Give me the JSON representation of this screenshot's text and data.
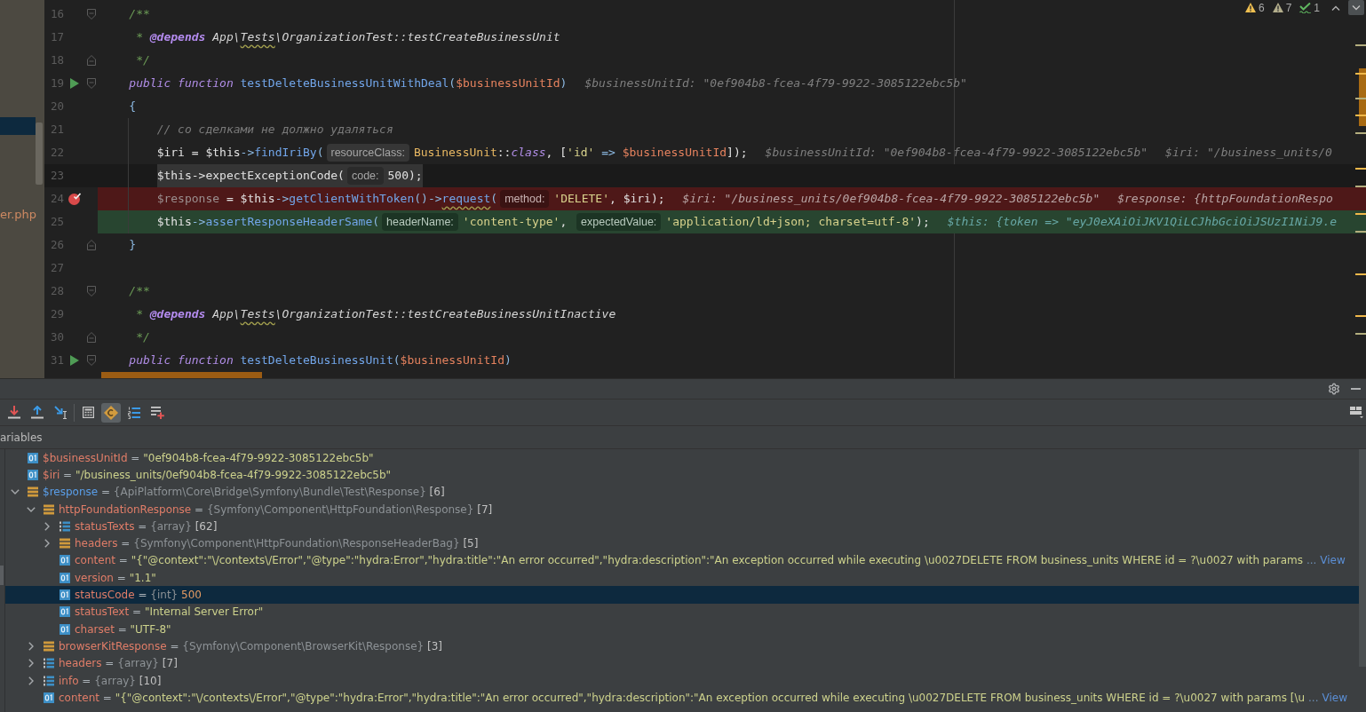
{
  "editor": {
    "project_panel": {
      "items": [
        {
          "selected": true
        },
        {
          "label": "er.php",
          "selected": false
        }
      ]
    },
    "problems": [
      {
        "kind": "warning",
        "count": "6"
      },
      {
        "kind": "weak_warning",
        "count": "7"
      },
      {
        "kind": "typo",
        "count": "1"
      }
    ],
    "lines": [
      {
        "number": "16",
        "kind": "code",
        "gutter": [
          {
            "kind": "fold_start"
          }
        ],
        "tokens": [
          {
            "kind": "doc",
            "text": "/**"
          }
        ]
      },
      {
        "number": "17",
        "kind": "code",
        "tokens": [
          {
            "kind": "doc",
            "text": " * "
          },
          {
            "kind": "doctag",
            "text": "@depends"
          },
          {
            "kind": "docref",
            "text": " App\\"
          },
          {
            "kind": "docref_typo",
            "text": "Tests"
          },
          {
            "kind": "docref",
            "text": "\\OrganizationTest::testCreateBusinessUnit"
          }
        ]
      },
      {
        "number": "18",
        "kind": "code",
        "gutter": [
          {
            "kind": "fold_end"
          }
        ],
        "tokens": [
          {
            "kind": "doc",
            "text": " */"
          }
        ]
      },
      {
        "number": "19",
        "kind": "code",
        "gutter": [
          {
            "kind": "run"
          },
          {
            "kind": "fold_start"
          }
        ],
        "tokens": [
          {
            "kind": "keyword",
            "text": "public function "
          },
          {
            "kind": "funcdef",
            "text": "testDeleteBusinessUnitWithDeal"
          },
          {
            "kind": "punct",
            "text": "("
          },
          {
            "kind": "param",
            "text": "$businessUnitId"
          },
          {
            "kind": "punct",
            "text": ")"
          },
          {
            "kind": "debug",
            "text": "$businessUnitId: \"0ef904b8-fcea-4f79-9922-3085122ebc5b\""
          }
        ]
      },
      {
        "number": "20",
        "kind": "code",
        "tokens": [
          {
            "kind": "punct",
            "text": "{"
          }
        ],
        "children": [
          {
            "number": "21",
            "kind": "code",
            "tokens": [
              {
                "kind": "comment",
                "text": "// со сделками не должно удаляться"
              }
            ]
          },
          {
            "number": "22",
            "kind": "code",
            "tokens": [
              {
                "kind": "var",
                "text": "$iri"
              },
              {
                "kind": "plain",
                "text": " = "
              },
              {
                "kind": "var",
                "text": "$this"
              },
              {
                "kind": "punct",
                "text": "->"
              },
              {
                "kind": "method",
                "text": "findIriBy"
              },
              {
                "kind": "punct",
                "text": "("
              },
              {
                "kind": "hint",
                "text": "resourceClass:"
              },
              {
                "kind": "class",
                "text": "BusinessUnit"
              },
              {
                "kind": "plain",
                "text": "::"
              },
              {
                "kind": "const",
                "text": "class"
              },
              {
                "kind": "plain",
                "text": ", ["
              },
              {
                "kind": "string",
                "text": "'id'"
              },
              {
                "kind": "punct",
                "text": " => "
              },
              {
                "kind": "param",
                "text": "$businessUnitId"
              },
              {
                "kind": "plain",
                "text": "]);"
              },
              {
                "kind": "debug",
                "text": "$businessUnitId: \"0ef904b8-fcea-4f79-9922-3085122ebc5b\""
              },
              {
                "kind": "debug",
                "text": "$iri: \"/business_units/0"
              }
            ]
          },
          {
            "number": "23",
            "kind": "caret",
            "tokens": [
              {
                "kind": "plain",
                "text": "$this->expectExceptionCode("
              },
              {
                "kind": "hint",
                "text": "code:"
              },
              {
                "kind": "plain",
                "text": "500);"
              }
            ]
          },
          {
            "number": "24",
            "kind": "breakpoint",
            "gutter": [
              {
                "kind": "breakpoint"
              }
            ],
            "tokens": [
              {
                "kind": "unused",
                "text": "$response"
              },
              {
                "kind": "plain",
                "text": " = "
              },
              {
                "kind": "var",
                "text": "$this"
              },
              {
                "kind": "punct",
                "text": "->"
              },
              {
                "kind": "method",
                "text": "getClientWithToken"
              },
              {
                "kind": "punct",
                "text": "()->"
              },
              {
                "kind": "method_typo",
                "text": "request"
              },
              {
                "kind": "punct",
                "text": "("
              },
              {
                "kind": "hint",
                "text": "method:"
              },
              {
                "kind": "string",
                "text": "'DELETE'"
              },
              {
                "kind": "plain",
                "text": ", "
              },
              {
                "kind": "var",
                "text": "$iri"
              },
              {
                "kind": "plain",
                "text": ");"
              },
              {
                "kind": "debug",
                "text": "$iri: \"/business_units/0ef904b8-fcea-4f79-9922-3085122ebc5b\""
              },
              {
                "kind": "debug",
                "text": "$response: {httpFoundationRespo"
              }
            ]
          },
          {
            "number": "25",
            "kind": "execution",
            "tokens": [
              {
                "kind": "var",
                "text": "$this"
              },
              {
                "kind": "punct",
                "text": "->"
              },
              {
                "kind": "method",
                "text": "assertResponseHeaderSame"
              },
              {
                "kind": "punct",
                "text": "("
              },
              {
                "kind": "hint",
                "text": "headerName:"
              },
              {
                "kind": "string",
                "text": "'content-type'"
              },
              {
                "kind": "plain",
                "text": ", "
              },
              {
                "kind": "hint",
                "text": "expectedValue:"
              },
              {
                "kind": "string",
                "text": "'application/ld+json; charset=utf-8'"
              },
              {
                "kind": "plain",
                "text": ");"
              },
              {
                "kind": "debug",
                "text": "$this: {token => \"eyJ0eXAiOiJKV1QiLCJhbGciOiJSUzI1NiJ9.e"
              }
            ]
          }
        ]
      },
      {
        "number": "26",
        "kind": "code",
        "gutter": [
          {
            "kind": "fold_end"
          }
        ],
        "tokens": [
          {
            "kind": "punct",
            "text": "}"
          }
        ]
      },
      {
        "number": "27",
        "kind": "code"
      },
      {
        "number": "28",
        "kind": "code",
        "gutter": [
          {
            "kind": "fold_start"
          }
        ],
        "tokens": [
          {
            "kind": "doc",
            "text": "/**"
          }
        ]
      },
      {
        "number": "29",
        "kind": "code",
        "tokens": [
          {
            "kind": "doc",
            "text": " * "
          },
          {
            "kind": "doctag",
            "text": "@depends"
          },
          {
            "kind": "docref",
            "text": " App\\"
          },
          {
            "kind": "docref_typo",
            "text": "Tests"
          },
          {
            "kind": "docref",
            "text": "\\OrganizationTest::testCreateBusinessUnitInactive"
          }
        ]
      },
      {
        "number": "30",
        "kind": "code",
        "gutter": [
          {
            "kind": "fold_end"
          }
        ],
        "tokens": [
          {
            "kind": "doc",
            "text": " */"
          }
        ]
      },
      {
        "number": "31",
        "kind": "code",
        "gutter": [
          {
            "kind": "run"
          },
          {
            "kind": "fold_start"
          }
        ],
        "tokens": [
          {
            "kind": "keyword",
            "text": "public function "
          },
          {
            "kind": "funcdef",
            "text": "testDeleteBusinessUnit"
          },
          {
            "kind": "punct",
            "text": "("
          },
          {
            "kind": "param",
            "text": "$businessUnitId"
          },
          {
            "kind": "punct",
            "text": ")"
          }
        ]
      }
    ]
  },
  "debugger": {
    "toolbar": [
      {
        "kind": "step_into",
        "on": false
      },
      {
        "kind": "step_out",
        "on": false
      },
      {
        "kind": "run_to_cursor",
        "on": false
      },
      {
        "kind": "evaluate",
        "on": false
      },
      {
        "kind": "constants",
        "on": true
      },
      {
        "kind": "array_view",
        "on": false
      },
      {
        "kind": "add_watch",
        "on": false
      }
    ],
    "variables_title": "ariables",
    "variables": [
      {
        "name": "$businessUnitId",
        "op": "=",
        "kind": "string",
        "value": "\"0ef904b8-fcea-4f79-9922-3085122ebc5b\"",
        "changed": false,
        "selected": false
      },
      {
        "name": "$iri",
        "op": "=",
        "kind": "string",
        "value": "\"/business_units/0ef904b8-fcea-4f79-9922-3085122ebc5b\"",
        "changed": false,
        "selected": false
      },
      {
        "name": "$response",
        "op": "=",
        "kind": "object",
        "type": "{ApiPlatform\\Core\\Bridge\\Symfony\\Bundle\\Test\\Response}",
        "size": "[6]",
        "changed": true,
        "selected": false,
        "expanded": true,
        "children": [
          {
            "name": "httpFoundationResponse",
            "op": "=",
            "kind": "object",
            "type": "{Symfony\\Component\\HttpFoundation\\Response}",
            "size": "[7]",
            "changed": false,
            "selected": false,
            "expanded": true,
            "children": [
              {
                "name": "statusTexts",
                "op": "=",
                "kind": "array",
                "type": "{array}",
                "size": "[62]",
                "changed": false,
                "selected": false,
                "expanded": false
              },
              {
                "name": "headers",
                "op": "=",
                "kind": "object",
                "type": "{Symfony\\Component\\HttpFoundation\\ResponseHeaderBag}",
                "size": "[5]",
                "changed": false,
                "selected": false,
                "expanded": false
              },
              {
                "name": "content",
                "op": "=",
                "kind": "string",
                "value": "\"{\"@context\":\"\\/contexts\\/Error\",\"@type\":\"hydra:Error\",\"hydra:title\":\"An error occurred\",\"hydra:description\":\"An exception occurred while executing \\u0027DELETE FROM business_units WHERE id = ?\\u0027 with params",
                "more": "...",
                "link": "View",
                "changed": false,
                "selected": false
              },
              {
                "name": "version",
                "op": "=",
                "kind": "string",
                "value": "\"1.1\"",
                "changed": false,
                "selected": false
              },
              {
                "name": "statusCode",
                "op": "=",
                "kind": "int",
                "type": "{int}",
                "value": "500",
                "changed": false,
                "selected": true
              },
              {
                "name": "statusText",
                "op": "=",
                "kind": "string",
                "value": "\"Internal Server Error\"",
                "changed": false,
                "selected": false
              },
              {
                "name": "charset",
                "op": "=",
                "kind": "string",
                "value": "\"UTF-8\"",
                "changed": false,
                "selected": false
              }
            ]
          },
          {
            "name": "browserKitResponse",
            "op": "=",
            "kind": "object",
            "type": "{Symfony\\Component\\BrowserKit\\Response}",
            "size": "[3]",
            "changed": false,
            "selected": false,
            "expanded": false
          },
          {
            "name": "headers",
            "op": "=",
            "kind": "array",
            "type": "{array}",
            "size": "[7]",
            "changed": false,
            "selected": false,
            "expanded": false
          },
          {
            "name": "info",
            "op": "=",
            "kind": "array",
            "type": "{array}",
            "size": "[10]",
            "changed": false,
            "selected": false,
            "expanded": false
          },
          {
            "name": "content",
            "op": "=",
            "kind": "string",
            "value": "\"{\"@context\":\"\\/contexts\\/Error\",\"@type\":\"hydra:Error\",\"hydra:title\":\"An error occurred\",\"hydra:description\":\"An exception occurred while executing \\u0027DELETE FROM business_units WHERE id = ?\\u0027 with params [\\u",
            "more": "...",
            "link": "View",
            "changed": false,
            "selected": false
          }
        ]
      }
    ]
  }
}
